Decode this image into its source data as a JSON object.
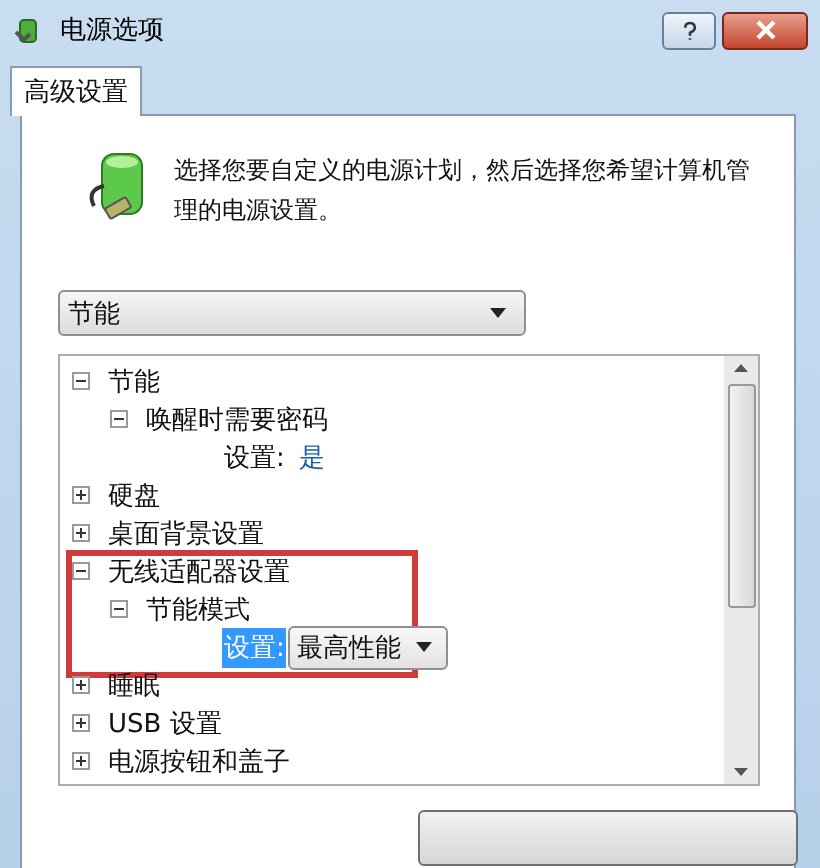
{
  "window": {
    "title": "电源选项"
  },
  "tabs": [
    {
      "label": "高级设置",
      "selected": true
    }
  ],
  "intro": "选择您要自定义的电源计划，然后选择您希望计算机管理的电源设置。",
  "plan_select": {
    "value": "节能"
  },
  "tree": [
    {
      "kind": "group",
      "label": "节能",
      "expanded": true,
      "highlighted": false,
      "children": [
        {
          "kind": "group",
          "label": "唤醒时需要密码",
          "expanded": true,
          "children": [
            {
              "kind": "setting",
              "label": "设置:",
              "value": "是",
              "selected": false
            }
          ]
        }
      ]
    },
    {
      "kind": "group",
      "label": "硬盘",
      "expanded": false,
      "highlighted": false
    },
    {
      "kind": "group",
      "label": "桌面背景设置",
      "expanded": false,
      "highlighted": false
    },
    {
      "kind": "group",
      "label": "无线适配器设置",
      "expanded": true,
      "highlighted": true,
      "children": [
        {
          "kind": "group",
          "label": "节能模式",
          "expanded": true,
          "children": [
            {
              "kind": "setting-select",
              "label": "设置:",
              "value": "最高性能",
              "selected": true
            }
          ]
        }
      ]
    },
    {
      "kind": "group",
      "label": "睡眠",
      "expanded": false,
      "highlighted": false
    },
    {
      "kind": "group",
      "label": "USB 设置",
      "expanded": false,
      "highlighted": false
    },
    {
      "kind": "group",
      "label": "电源按钮和盖子",
      "expanded": false,
      "highlighted": false
    }
  ]
}
